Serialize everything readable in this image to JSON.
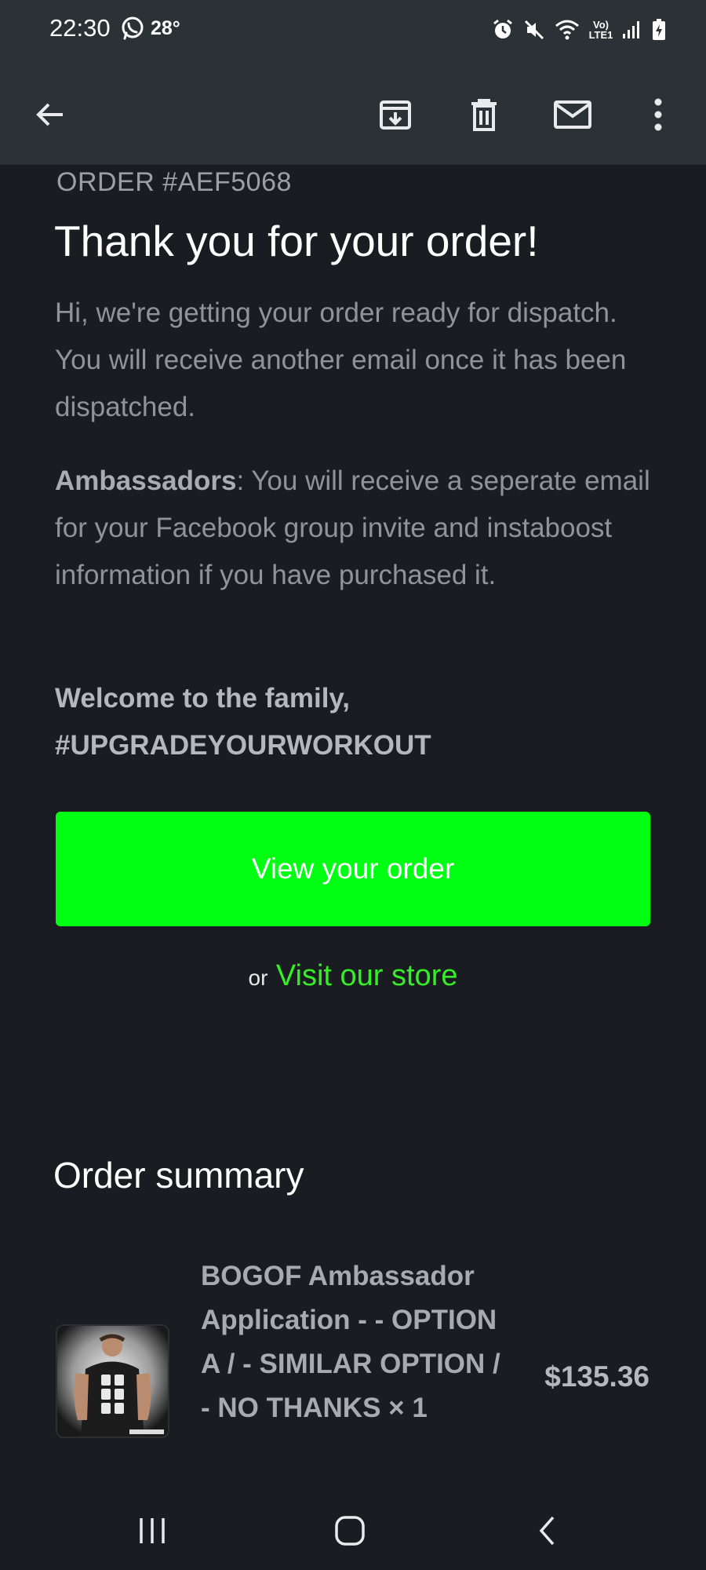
{
  "status_bar": {
    "time": "22:30",
    "temperature": "28°",
    "network_label": "Vo) LTE1",
    "icons": [
      "whatsapp-icon",
      "alarm-icon",
      "mute-icon",
      "wifi-icon",
      "signal-icon",
      "battery-icon"
    ]
  },
  "toolbar": {
    "icons": [
      "back-arrow-icon",
      "archive-icon",
      "delete-icon",
      "mark-unread-icon",
      "more-options-icon"
    ]
  },
  "email": {
    "order_number": "ORDER #AEF5068",
    "heading": "Thank you for your order!",
    "paragraph1": "Hi, we're getting your order ready for dispatch. You will receive another email once it has been dispatched.",
    "ambassadors_label": "Ambassadors",
    "paragraph2_rest": ": You will receive a seperate email for your Facebook group invite and instaboost information if you have purchased it.",
    "welcome_line1": "Welcome to the family,",
    "welcome_line2": "#UPGRADEYOURWORKOUT",
    "cta_label": "View your order",
    "or_text": "or",
    "store_link": "Visit our store",
    "cta_color": "#00ff12",
    "link_color": "#34ee26"
  },
  "order_summary": {
    "title": "Order summary",
    "items": [
      {
        "title": "BOGOF Ambassador Application - - OPTION A / - SIMILAR OPTION / - NO THANKS × 1",
        "price": "$135.36"
      }
    ]
  },
  "nav_bar": {
    "icons": [
      "recent-apps-icon",
      "home-icon",
      "back-icon"
    ]
  }
}
